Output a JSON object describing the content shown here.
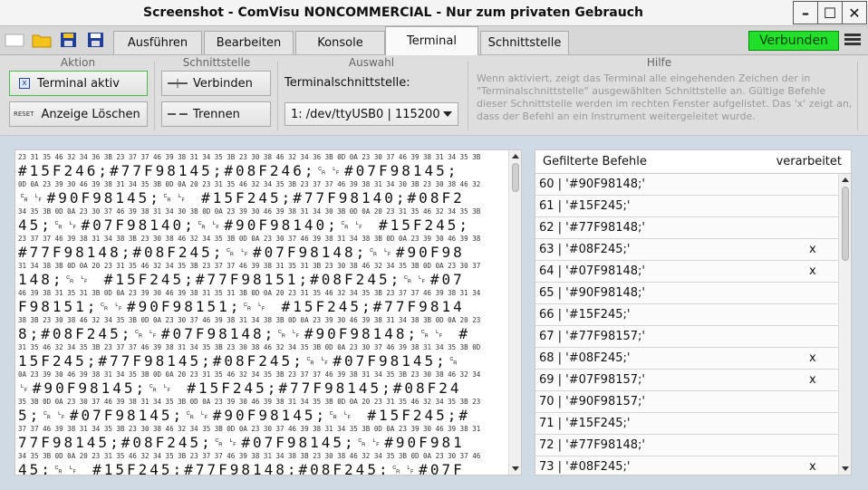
{
  "window": {
    "title": "Screenshot - ComVisu NONCOMMERCIAL - Nur zum privaten Gebrauch",
    "minimize": "–",
    "maximize": "☐",
    "close": "✕"
  },
  "tabs": [
    {
      "label": "Ausführen",
      "active": false
    },
    {
      "label": "Bearbeiten",
      "active": false
    },
    {
      "label": "Konsole",
      "active": false
    },
    {
      "label": "Terminal",
      "active": true
    },
    {
      "label": "Schnittstelle",
      "active": false
    }
  ],
  "status": {
    "label": "Verbunden",
    "color": "#22e02a"
  },
  "ribbon": {
    "aktion": {
      "label": "Aktion",
      "terminal_aktiv": "Terminal aktiv",
      "terminal_aktiv_icon_glyph": "x",
      "reset_icon_text": "RESET",
      "anzeige_loeschen": "Anzeige Löschen"
    },
    "schnittstelle": {
      "label": "Schnittstelle",
      "verbinden": "Verbinden",
      "trennen": "Trennen"
    },
    "auswahl": {
      "label": "Auswahl",
      "field_label": "Terminalschnittstelle:",
      "selected": "1: /dev/ttyUSB0 | 115200"
    },
    "hilfe": {
      "label": "Hilfe",
      "text": "Wenn aktiviert, zeigt das Terminal alle eingehenden Zeichen der in \"Terminalschnittstelle\" ausgewählten Schnittstelle an. Gültige Befehle dieser Schnittstelle werden im rechten Fenster aufgelistet. Das 'x' zeigt an, dass der Befehl an ein Instrument weitergeleitet wurde."
    }
  },
  "terminal": {
    "lines": [
      {
        "hex": "23 31 35 46 32 34 36 3B 23 37 37 46 39 38 31 34 35 3B 23 30 38 46 32 34 36 3B 0D 0A 23 30 37 46 39 38 31 34 35 3B",
        "text": "#15F246;#77F98145;#08F246;␍␊#07F98145;"
      },
      {
        "hex": "0D 0A 23 39 30 46 39 38 31 34 35 3B 0D 0A 20 23 31 35 46 32 34 35 3B 23 37 37 46 39 38 31 34 30 3B 23 30 38 46 32",
        "text": "␍␊#90F98145;␍␊ #15F245;#77F98140;#08F2"
      },
      {
        "hex": "34 35 3B 0D 0A 23 30 37 46 39 38 31 34 30 3B 0D 0A 23 39 30 46 39 38 31 34 30 3B 0D 0A 20 23 31 35 46 32 34 35 3B",
        "text": "45;␍␊#07F98140;␍␊#90F98140;␍␊ #15F245;"
      },
      {
        "hex": "23 37 37 46 39 38 31 34 38 3B 23 30 38 46 32 34 35 3B 0D 0A 23 30 37 46 39 38 31 34 38 3B 0D 0A 23 39 30 46 39 38",
        "text": "#77F98148;#08F245;␍␊#07F98148;␍␊#90F98"
      },
      {
        "hex": "31 34 38 3B 0D 0A 20 23 31 35 46 32 34 35 3B 23 37 37 46 39 38 31 35 31 3B 23 30 38 46 32 34 35 3B 0D 0A 23 30 37",
        "text": "148;␍␊ #15F245;#77F98151;#08F245;␍␊#07"
      },
      {
        "hex": "46 39 38 31 35 31 3B 0D 0A 23 39 30 46 39 38 31 35 31 3B 0D 0A 20 23 31 35 46 32 34 35 3B 23 37 37 46 39 38 31 34",
        "text": "F98151;␍␊#90F98151;␍␊ #15F245;#77F9814"
      },
      {
        "hex": "38 3B 23 30 38 46 32 34 35 3B 0D 0A 23 30 37 46 39 38 31 34 38 3B 0D 0A 23 39 30 46 39 38 31 34 38 3B 0D 0A 20 23",
        "text": "8;#08F245;␍␊#07F98148;␍␊#90F98148;␍␊ #"
      },
      {
        "hex": "31 35 46 32 34 35 3B 23 37 37 46 39 38 31 34 35 3B 23 30 38 46 32 34 35 3B 0D 0A 23 30 37 46 39 38 31 34 35 3B 0D",
        "text": "15F245;#77F98145;#08F245;␍␊#07F98145;␍"
      },
      {
        "hex": "0A 23 39 30 46 39 38 31 34 35 3B 0D 0A 20 23 31 35 46 32 34 35 3B 23 37 37 46 39 38 31 34 35 3B 23 30 38 46 32 34",
        "text": "␊#90F98145;␍␊ #15F245;#77F98145;#08F24"
      },
      {
        "hex": "35 3B 0D 0A 23 30 37 46 39 38 31 34 35 3B 0D 0A 23 39 30 46 39 38 31 34 35 3B 0D 0A 20 23 31 35 46 32 34 35 3B 23",
        "text": "5;␍␊#07F98145;␍␊#90F98145;␍␊ #15F245;#"
      },
      {
        "hex": "37 37 46 39 38 31 34 35 3B 23 30 38 46 32 34 35 3B 0D 0A 23 30 37 46 39 38 31 34 35 3B 0D 0A 23 39 30 46 39 38 31",
        "text": "77F98145;#08F245;␍␊#07F98145;␍␊#90F981"
      },
      {
        "hex": "34 35 3B 0D 0A 20 23 31 35 46 32 34 35 3B 23 37 37 46 39 38 31 34 38 3B 23 30 38 46 32 34 35 3B 0D 0A 23 30 37 46",
        "text": "45;␍␊ #15F245;#77F98148;#08F245;␍␊#07F"
      }
    ]
  },
  "commands": {
    "header_left": "Gefilterte Befehle",
    "header_right": "verarbeitet",
    "rows": [
      {
        "cmd": "60 | '#90F98148;'",
        "mark": ""
      },
      {
        "cmd": "61 | '#15F245;'",
        "mark": ""
      },
      {
        "cmd": "62 | '#77F98148;'",
        "mark": ""
      },
      {
        "cmd": "63 | '#08F245;'",
        "mark": "x"
      },
      {
        "cmd": "64 | '#07F98148;'",
        "mark": "x"
      },
      {
        "cmd": "65 | '#90F98148;'",
        "mark": ""
      },
      {
        "cmd": "66 | '#15F245;'",
        "mark": ""
      },
      {
        "cmd": "67 | '#77F98157;'",
        "mark": ""
      },
      {
        "cmd": "68 | '#08F245;'",
        "mark": "x"
      },
      {
        "cmd": "69 | '#07F98157;'",
        "mark": "x"
      },
      {
        "cmd": "70 | '#90F98157;'",
        "mark": ""
      },
      {
        "cmd": "71 | '#15F245;'",
        "mark": ""
      },
      {
        "cmd": "72 | '#77F98148;'",
        "mark": ""
      },
      {
        "cmd": "73 | '#08F245;'",
        "mark": "x"
      }
    ]
  }
}
